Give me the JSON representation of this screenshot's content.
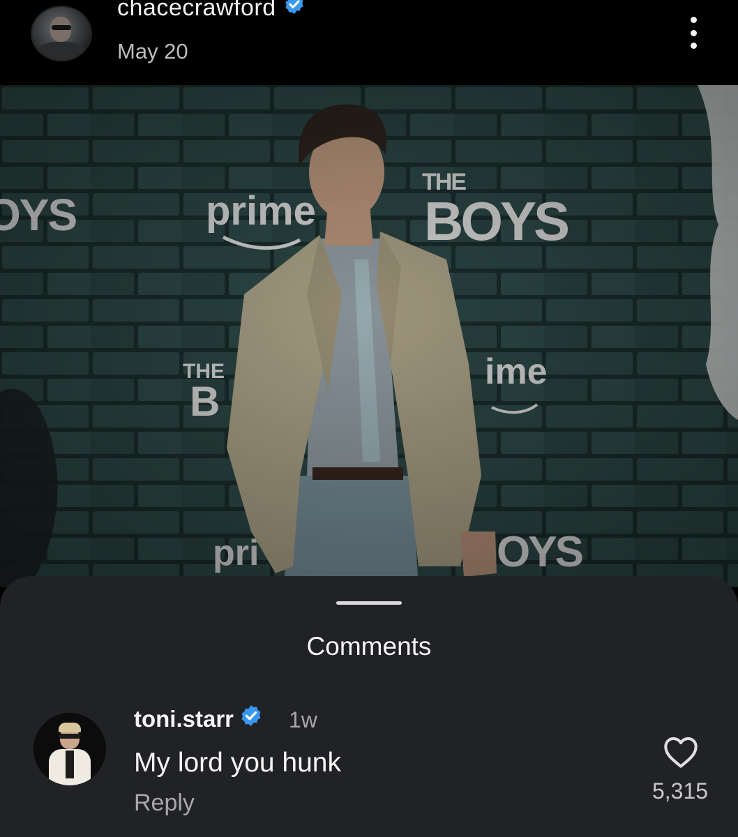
{
  "post": {
    "username": "chacecrawford",
    "date": "May 20",
    "verified": true,
    "photo": {
      "signage": [
        "prime",
        "prime",
        "pri",
        "ime",
        "THE BOYS"
      ],
      "backdrop_color": "#2e4a48"
    }
  },
  "comments_sheet": {
    "title": "Comments",
    "comments": [
      {
        "username": "toni.starr",
        "verified": true,
        "time": "1w",
        "text": "My lord you hunk",
        "reply_label": "Reply",
        "likes": "5,315"
      }
    ]
  },
  "icons": {
    "verified": "verified-badge-icon",
    "more": "more-options-icon",
    "like": "heart-outline-icon"
  },
  "colors": {
    "verified": "#3897f0",
    "sheet_bg": "#212226",
    "secondary_text": "#a8a8a8"
  }
}
